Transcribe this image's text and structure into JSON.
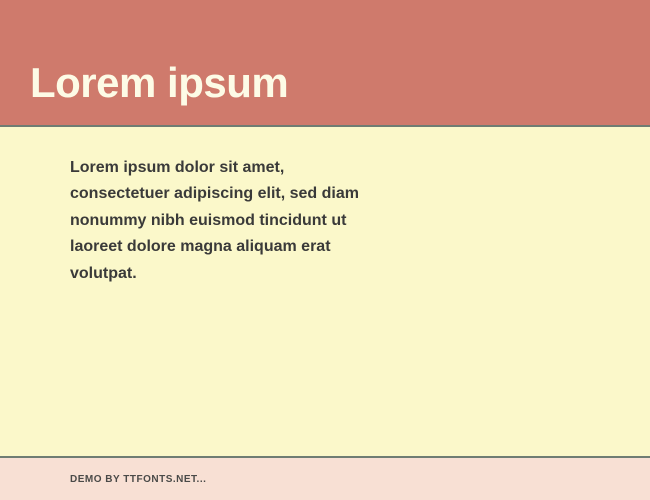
{
  "header": {
    "title": "Lorem ipsum"
  },
  "content": {
    "body": "Lorem ipsum dolor sit amet, consectetuer adipiscing elit, sed diam nonummy nibh euismod tincidunt ut laoreet dolore magna aliquam erat volutpat."
  },
  "footer": {
    "credit": "DEMO BY TTFONTS.NET..."
  }
}
